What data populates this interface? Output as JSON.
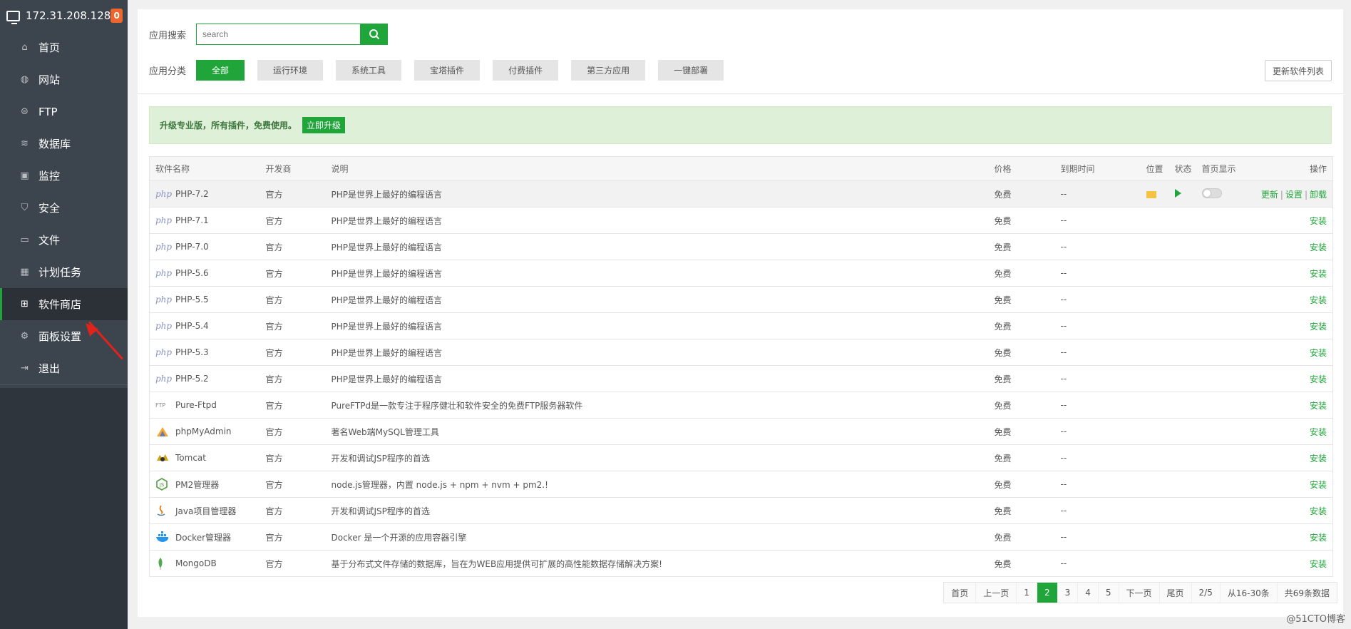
{
  "sidebar": {
    "ip": "172.31.208.128",
    "badge": "0",
    "items": [
      {
        "label": "首页",
        "icon": "home-icon"
      },
      {
        "label": "网站",
        "icon": "globe-icon"
      },
      {
        "label": "FTP",
        "icon": "ftp-icon"
      },
      {
        "label": "数据库",
        "icon": "database-icon"
      },
      {
        "label": "监控",
        "icon": "monitor-icon"
      },
      {
        "label": "安全",
        "icon": "shield-icon"
      },
      {
        "label": "文件",
        "icon": "folder-icon"
      },
      {
        "label": "计划任务",
        "icon": "calendar-icon"
      },
      {
        "label": "软件商店",
        "icon": "grid-icon"
      },
      {
        "label": "面板设置",
        "icon": "gear-icon"
      },
      {
        "label": "退出",
        "icon": "logout-icon"
      }
    ],
    "add_label": "+"
  },
  "search": {
    "label": "应用搜索",
    "placeholder": "search"
  },
  "categories": {
    "label": "应用分类",
    "items": [
      "全部",
      "运行环境",
      "系统工具",
      "宝塔插件",
      "付费插件",
      "第三方应用",
      "一键部署"
    ]
  },
  "update_list_label": "更新软件列表",
  "promo": {
    "text": "升级专业版，所有插件，免费使用。",
    "button": "立即升级"
  },
  "table": {
    "headers": [
      "软件名称",
      "开发商",
      "说明",
      "价格",
      "到期时间",
      "位置",
      "状态",
      "首页显示",
      "操作"
    ],
    "rows": [
      {
        "name": "PHP-7.2",
        "dev": "官方",
        "desc": "PHP是世界上最好的编程语言",
        "price": "免费",
        "expire": "--",
        "logo": "php"
      },
      {
        "name": "PHP-7.1",
        "dev": "官方",
        "desc": "PHP是世界上最好的编程语言",
        "price": "免费",
        "expire": "--",
        "logo": "php"
      },
      {
        "name": "PHP-7.0",
        "dev": "官方",
        "desc": "PHP是世界上最好的编程语言",
        "price": "免费",
        "expire": "--",
        "logo": "php"
      },
      {
        "name": "PHP-5.6",
        "dev": "官方",
        "desc": "PHP是世界上最好的编程语言",
        "price": "免费",
        "expire": "--",
        "logo": "php"
      },
      {
        "name": "PHP-5.5",
        "dev": "官方",
        "desc": "PHP是世界上最好的编程语言",
        "price": "免费",
        "expire": "--",
        "logo": "php"
      },
      {
        "name": "PHP-5.4",
        "dev": "官方",
        "desc": "PHP是世界上最好的编程语言",
        "price": "免费",
        "expire": "--",
        "logo": "php"
      },
      {
        "name": "PHP-5.3",
        "dev": "官方",
        "desc": "PHP是世界上最好的编程语言",
        "price": "免费",
        "expire": "--",
        "logo": "php"
      },
      {
        "name": "PHP-5.2",
        "dev": "官方",
        "desc": "PHP是世界上最好的编程语言",
        "price": "免费",
        "expire": "--",
        "logo": "php"
      },
      {
        "name": "Pure-Ftpd",
        "dev": "官方",
        "desc": "PureFTPd是一款专注于程序健壮和软件安全的免费FTP服务器软件",
        "price": "免费",
        "expire": "--",
        "logo": "ftp"
      },
      {
        "name": "phpMyAdmin",
        "dev": "官方",
        "desc": "著名Web端MySQL管理工具",
        "price": "免费",
        "expire": "--",
        "logo": "phpmyadmin"
      },
      {
        "name": "Tomcat",
        "dev": "官方",
        "desc": "开发和调试JSP程序的首选",
        "price": "免费",
        "expire": "--",
        "logo": "tomcat"
      },
      {
        "name": "PM2管理器",
        "dev": "官方",
        "desc": "node.js管理器，内置 node.js + npm + nvm + pm2.!",
        "price": "免费",
        "expire": "--",
        "logo": "node"
      },
      {
        "name": "Java项目管理器",
        "dev": "官方",
        "desc": "开发和调试JSP程序的首选",
        "price": "免费",
        "expire": "--",
        "logo": "java"
      },
      {
        "name": "Docker管理器",
        "dev": "官方",
        "desc": "Docker 是一个开源的应用容器引擎",
        "price": "免费",
        "expire": "--",
        "logo": "docker"
      },
      {
        "name": "MongoDB",
        "dev": "官方",
        "desc": "基于分布式文件存储的数据库，旨在为WEB应用提供可扩展的高性能数据存储解决方案!",
        "price": "免费",
        "expire": "--",
        "logo": "mongodb"
      }
    ],
    "ops_installed": [
      "更新",
      "设置",
      "卸载"
    ],
    "install_label": "安装"
  },
  "logos": {
    "php": "php",
    "ftp": "FTP"
  },
  "pager": {
    "first": "首页",
    "prev": "上一页",
    "pages": [
      "1",
      "2",
      "3",
      "4",
      "5"
    ],
    "current": "2",
    "next": "下一页",
    "last": "尾页",
    "page_info": "2/5",
    "range": "从16-30条",
    "total": "共69条数据"
  },
  "watermark": "@51CTO博客",
  "colors": {
    "accent": "#20a53a",
    "sidebar": "#3c444d",
    "badge": "#f0652d"
  }
}
